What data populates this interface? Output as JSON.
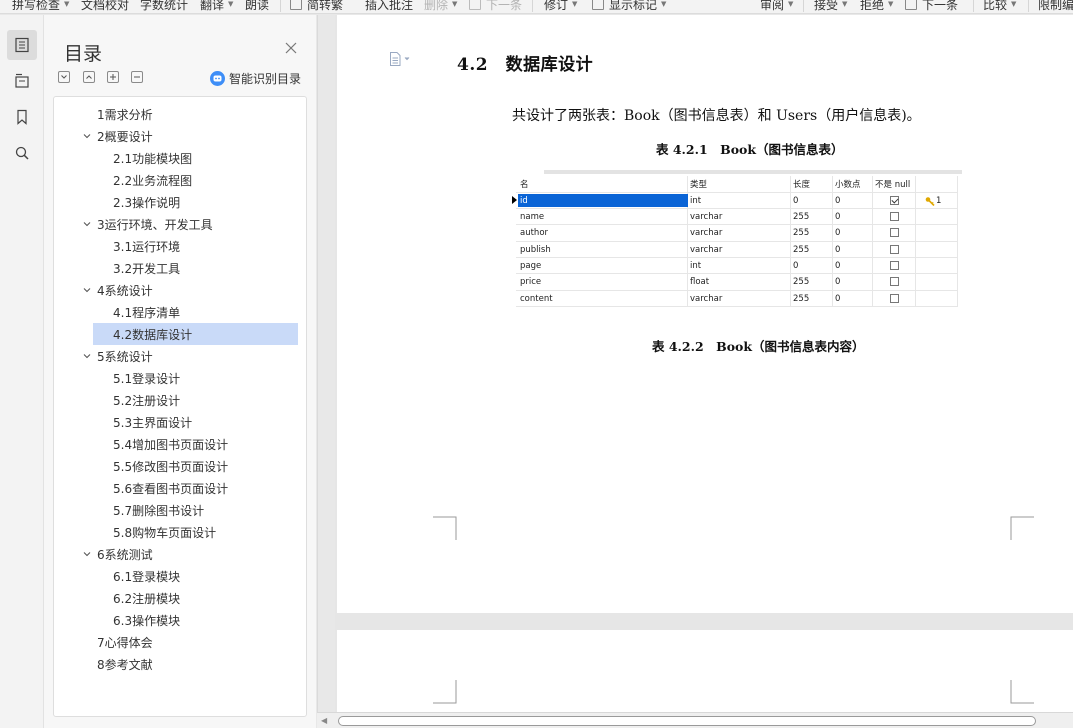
{
  "toolbar": {
    "items": {
      "spell_check": "拼写检查",
      "doc_proof": "文档校对",
      "word_count": "字数统计",
      "translate": "翻译",
      "read_aloud": "朗读",
      "simp_trad": "简转繁",
      "insert_comment": "插入批注",
      "delete": "删除",
      "next_comment": "下一条",
      "revise": "修订",
      "show_markup": "显示标记",
      "review": "审阅",
      "accept": "接受",
      "reject": "拒绝",
      "next_change": "下一条",
      "compare": "比较",
      "restrict_edit": "限制编"
    }
  },
  "toc": {
    "title": "目录",
    "smart_label": "智能识别目录",
    "items": [
      {
        "label": "1需求分析"
      },
      {
        "label": "2概要设计"
      },
      {
        "label": "2.1功能模块图"
      },
      {
        "label": "2.2业务流程图"
      },
      {
        "label": "2.3操作说明"
      },
      {
        "label": "3运行环境、开发工具"
      },
      {
        "label": "3.1运行环境"
      },
      {
        "label": "3.2开发工具"
      },
      {
        "label": "4系统设计"
      },
      {
        "label": "4.1程序清单"
      },
      {
        "label": "4.2数据库设计"
      },
      {
        "label": "5系统设计"
      },
      {
        "label": "5.1登录设计"
      },
      {
        "label": "5.2注册设计"
      },
      {
        "label": "5.3主界面设计"
      },
      {
        "label": "5.4增加图书页面设计"
      },
      {
        "label": "5.5修改图书页面设计"
      },
      {
        "label": "5.6查看图书页面设计"
      },
      {
        "label": "5.7删除图书设计"
      },
      {
        "label": "5.8购物车页面设计"
      },
      {
        "label": "6系统测试"
      },
      {
        "label": "6.1登录模块"
      },
      {
        "label": "6.2注册模块"
      },
      {
        "label": "6.3操作模块"
      },
      {
        "label": "7心得体会"
      },
      {
        "label": "8参考文献"
      }
    ]
  },
  "document": {
    "heading": "4.2　数据库设计",
    "intro": "共设计了两张表：Book（图书信息表）和 Users（用户信息表)。",
    "caption1": "表 4.2.1　Book（图书信息表）",
    "caption2": "表 4.2.2　Book（图书信息表内容）",
    "table": {
      "headers": {
        "name": "名",
        "type": "类型",
        "length": "长度",
        "decimals": "小数点",
        "not_null": "不是 null"
      },
      "rows": [
        {
          "name": "id",
          "type": "int",
          "length": "0",
          "decimals": "0",
          "not_null": true,
          "key": "1"
        },
        {
          "name": "name",
          "type": "varchar",
          "length": "255",
          "decimals": "0",
          "not_null": false
        },
        {
          "name": "author",
          "type": "varchar",
          "length": "255",
          "decimals": "0",
          "not_null": false
        },
        {
          "name": "publish",
          "type": "varchar",
          "length": "255",
          "decimals": "0",
          "not_null": false
        },
        {
          "name": "page",
          "type": "int",
          "length": "0",
          "decimals": "0",
          "not_null": false
        },
        {
          "name": "price",
          "type": "float",
          "length": "255",
          "decimals": "0",
          "not_null": false
        },
        {
          "name": "content",
          "type": "varchar",
          "length": "255",
          "decimals": "0",
          "not_null": false
        }
      ]
    }
  },
  "colors": {
    "accent": "#3e8ef7",
    "selected_toc": "#c9daf8",
    "table_selection": "#0a64d6"
  }
}
